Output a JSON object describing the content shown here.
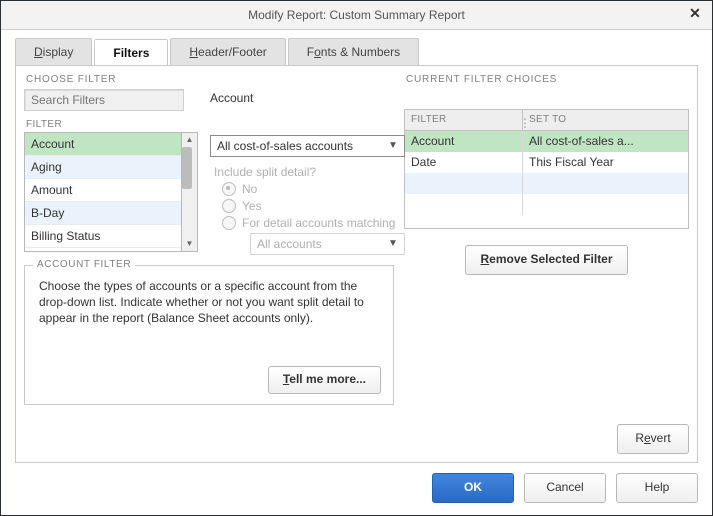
{
  "window": {
    "title": "Modify Report: Custom Summary Report"
  },
  "tabs": [
    {
      "label_pre": "D",
      "label_u": "isplay"
    },
    {
      "label_pre": "",
      "label_plain": "Filters"
    },
    {
      "label_pre": "H",
      "label_u": "eader/Footer"
    },
    {
      "label_pre": "F",
      "label_u": "o",
      "label_post": "nts & Numbers"
    }
  ],
  "choose": {
    "label": "CHOOSE FILTER",
    "search_placeholder": "Search Filters",
    "filter_header": "FILTER",
    "list": [
      {
        "label": "Account",
        "selected": true
      },
      {
        "label": "Aging"
      },
      {
        "label": "Amount"
      },
      {
        "label": "B-Day"
      },
      {
        "label": "Billing Status"
      }
    ],
    "detail": {
      "title": "Account",
      "combo": "All cost-of-sales accounts",
      "split_label": "Include split detail?",
      "no": "No",
      "yes": "Yes",
      "matching": "For detail accounts matching",
      "all_accounts": "All accounts"
    },
    "account_filter": {
      "legend": "ACCOUNT FILTER",
      "text": "Choose the types of accounts or a specific account from the drop-down list. Indicate whether or not you want split detail to appear in the report (Balance Sheet accounts only).",
      "tell_more_pre": "T",
      "tell_more_rest": "ell me more..."
    }
  },
  "current": {
    "label": "CURRENT FILTER CHOICES",
    "h_filter": "FILTER",
    "h_setto": "SET TO",
    "rows": [
      {
        "filter": "Account",
        "setto": "All cost-of-sales a...",
        "selected": true
      },
      {
        "filter": "Date",
        "setto": "This Fiscal Year"
      }
    ],
    "remove_pre": "R",
    "remove_rest": "emove Selected Filter",
    "revert_pre": "R",
    "revert_rest": "e",
    "revert_post": "vert"
  },
  "buttons": {
    "ok": "OK",
    "cancel": "Cancel",
    "help": "Help"
  }
}
